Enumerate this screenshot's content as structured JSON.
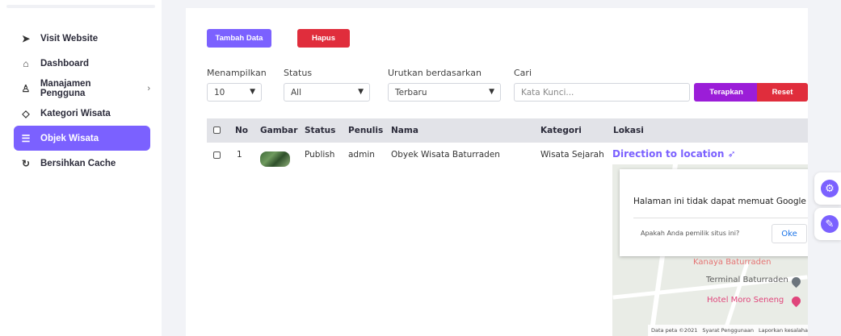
{
  "sidebar": {
    "items": [
      {
        "label": "Visit Website",
        "icon": "send-icon",
        "glyph": "➤"
      },
      {
        "label": "Dashboard",
        "icon": "home-icon",
        "glyph": "⌂"
      },
      {
        "label": "Manajamen Pengguna",
        "icon": "user-icon",
        "glyph": "♙",
        "chevron": "›"
      },
      {
        "label": "Kategori Wisata",
        "icon": "tag-icon",
        "glyph": "◇"
      },
      {
        "label": "Objek Wisata",
        "icon": "list-icon",
        "glyph": "☰",
        "active": true
      },
      {
        "label": "Bersihkan Cache",
        "icon": "refresh-icon",
        "glyph": "↻"
      }
    ]
  },
  "toolbar": {
    "add_label": "Tambah Data",
    "delete_label": "Hapus"
  },
  "filters": {
    "show": {
      "label": "Menampilkan",
      "value": "10"
    },
    "status": {
      "label": "Status",
      "value": "All"
    },
    "sort": {
      "label": "Urutkan berdasarkan",
      "value": "Terbaru"
    },
    "search": {
      "label": "Cari",
      "placeholder": "Kata Kunci..."
    },
    "apply_label": "Terapkan",
    "reset_label": "Reset"
  },
  "table": {
    "headers": [
      "No",
      "Gambar",
      "Status",
      "Penulis",
      "Nama",
      "Kategori",
      "Lokasi"
    ],
    "rows": [
      {
        "no": "1",
        "status": "Publish",
        "author": "admin",
        "name": "Obyek Wisata Baturraden",
        "category": "Wisata Sejarah",
        "location_link": "Direction to location ➶"
      }
    ]
  },
  "map": {
    "dialog_title": "Halaman ini tidak dapat memuat Google Maps dengan benar.",
    "dialog_question": "Apakah Anda pemilik situs ini?",
    "dialog_ok": "Oke",
    "labels": [
      "Kanaya Baturraden",
      "Terminal Baturraden",
      "Hotel Moro Seneng"
    ],
    "footer": [
      "Data peta ©2021",
      "Syarat Penggunaan",
      "Laporkan kesalahan peta"
    ]
  },
  "colors": {
    "accent": "#7b61ff",
    "danger": "#e02d3c",
    "apply": "#9b1dd8"
  }
}
